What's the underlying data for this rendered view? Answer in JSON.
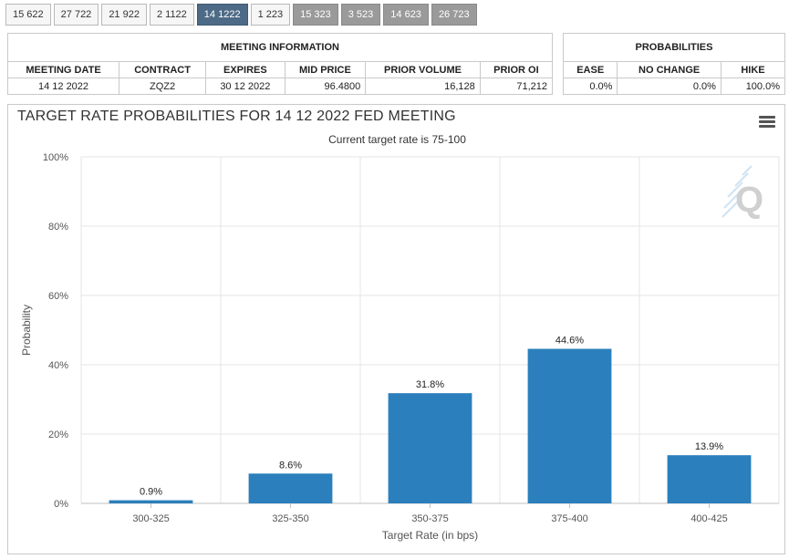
{
  "tabs": [
    {
      "label": "15 622",
      "state": "normal"
    },
    {
      "label": "27 722",
      "state": "normal"
    },
    {
      "label": "21 922",
      "state": "normal"
    },
    {
      "label": "2 1122",
      "state": "normal"
    },
    {
      "label": "14 1222",
      "state": "active"
    },
    {
      "label": "1 223",
      "state": "normal"
    },
    {
      "label": "15 323",
      "state": "future"
    },
    {
      "label": "3 523",
      "state": "future"
    },
    {
      "label": "14 623",
      "state": "future"
    },
    {
      "label": "26 723",
      "state": "future"
    }
  ],
  "meeting_info": {
    "heading": "MEETING INFORMATION",
    "columns": [
      "MEETING DATE",
      "CONTRACT",
      "EXPIRES",
      "MID PRICE",
      "PRIOR VOLUME",
      "PRIOR OI"
    ],
    "row": [
      "14 12 2022",
      "ZQZ2",
      "30 12 2022",
      "96.4800",
      "16,128",
      "71,212"
    ]
  },
  "probabilities": {
    "heading": "PROBABILITIES",
    "columns": [
      "EASE",
      "NO CHANGE",
      "HIKE"
    ],
    "row": [
      "0.0%",
      "0.0%",
      "100.0%"
    ]
  },
  "chart_data": {
    "type": "bar",
    "title": "TARGET RATE PROBABILITIES FOR 14 12 2022 FED MEETING",
    "subtitle": "Current target rate is 75-100",
    "xlabel": "Target Rate (in bps)",
    "ylabel": "Probability",
    "categories": [
      "300-325",
      "325-350",
      "350-375",
      "375-400",
      "400-425"
    ],
    "values": [
      0.9,
      8.6,
      31.8,
      44.6,
      13.9
    ],
    "data_labels": [
      "0.9%",
      "8.6%",
      "31.8%",
      "44.6%",
      "13.9%"
    ],
    "ylim": [
      0,
      100
    ],
    "yticks": [
      0,
      20,
      40,
      60,
      80,
      100
    ],
    "ytick_labels": [
      "0%",
      "20%",
      "40%",
      "60%",
      "80%",
      "100%"
    ],
    "grid": true,
    "bar_color": "#2b7fbc",
    "legend": "none"
  },
  "logo_letter": "Q"
}
